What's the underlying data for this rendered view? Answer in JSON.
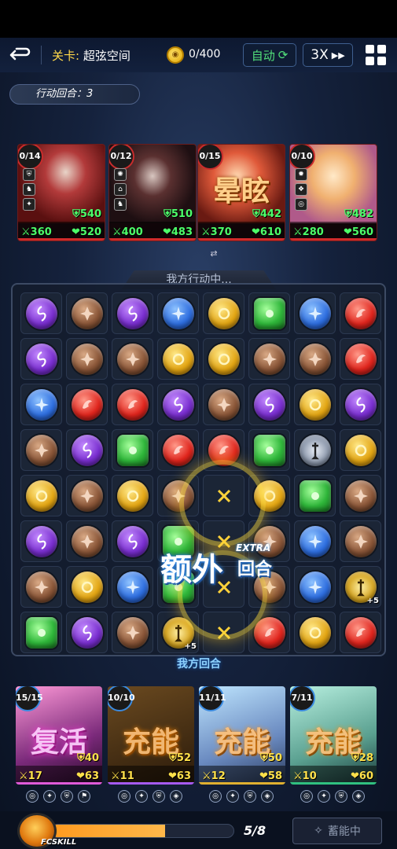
{
  "topbar": {
    "stage_label": "关卡:",
    "stage_name": "超弦空间",
    "coin_value": "0/400",
    "auto_label": "自动",
    "speed_label": "3X"
  },
  "turn": {
    "label": "行动回合：3"
  },
  "enemies": [
    {
      "counter": "0/14",
      "shield": "540",
      "atk": "360",
      "hp": "520",
      "status": ""
    },
    {
      "counter": "0/12",
      "shield": "510",
      "atk": "400",
      "hp": "483",
      "status": ""
    },
    {
      "counter": "0/15",
      "shield": "442",
      "atk": "370",
      "hp": "610",
      "status": "晕眩"
    },
    {
      "counter": "0/10",
      "shield": "482",
      "atk": "280",
      "hp": "560",
      "status": ""
    }
  ],
  "board": {
    "header": "我方行动中...",
    "footer": "我方回合",
    "extra_main": "额外",
    "extra_tag": "EXTRA",
    "extra_sub": "回合",
    "plus": "+5",
    "rows": [
      [
        "purple",
        "brown",
        "purple",
        "blue",
        "yellow",
        "green",
        "blue",
        "red"
      ],
      [
        "purple",
        "brown",
        "brown",
        "yellow",
        "yellow",
        "brown",
        "brown",
        "red"
      ],
      [
        "blue",
        "red",
        "red",
        "purple",
        "brown",
        "purple",
        "yellow",
        "purple"
      ],
      [
        "brown",
        "purple",
        "green",
        "red",
        "red",
        "green",
        "sword",
        "yellow"
      ],
      [
        "yellow",
        "brown",
        "yellow",
        "brown",
        "cross",
        "yellow",
        "green",
        "brown"
      ],
      [
        "purple",
        "brown",
        "purple",
        "green",
        "cross",
        "brown",
        "blue",
        "brown"
      ],
      [
        "brown",
        "yellow",
        "blue",
        "green",
        "cross",
        "brown",
        "blue",
        "gsword"
      ],
      [
        "green",
        "purple",
        "brown",
        "gsword",
        "cross",
        "red",
        "yellow",
        "red"
      ]
    ]
  },
  "heroes": [
    {
      "counter": "15/15",
      "shield": "40",
      "atk": "17",
      "hp": "63",
      "status": "复活",
      "bar": "#e05ad8"
    },
    {
      "counter": "10/10",
      "shield": "52",
      "atk": "11",
      "hp": "63",
      "status": "充能",
      "bar": "#a65af0"
    },
    {
      "counter": "11/11",
      "shield": "50",
      "atk": "12",
      "hp": "58",
      "status": "充能",
      "bar": "#e0b030"
    },
    {
      "counter": "7/11",
      "shield": "28",
      "atk": "10",
      "hp": "60",
      "status": "充能",
      "bar": "#30c080"
    }
  ],
  "footer": {
    "fc_label": "FCSKILL",
    "progress": 0.625,
    "count": "5/8",
    "store_label": "蓄能中"
  },
  "colors": {
    "accent_green": "#52e07a",
    "enemy_red": "#d12a2a",
    "gold": "#ffd84a"
  }
}
